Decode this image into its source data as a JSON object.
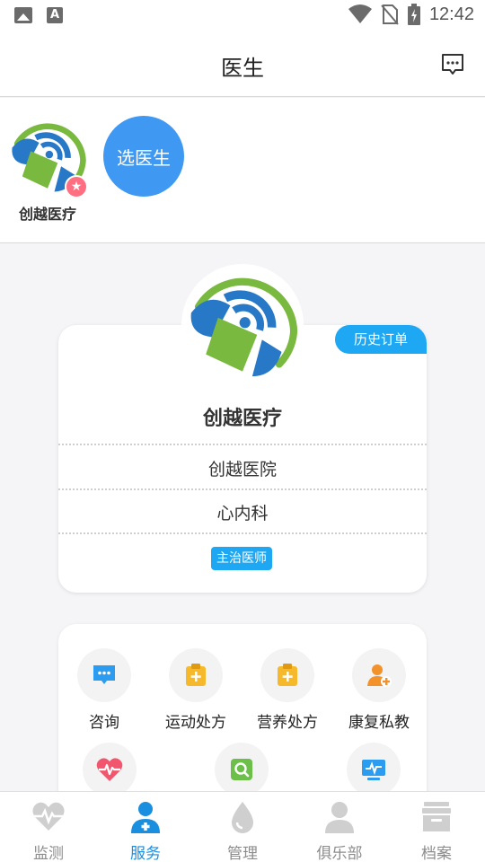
{
  "status_bar": {
    "time": "12:42",
    "icons": [
      "image-notification-icon",
      "accessibility-notification-icon",
      "wifi-icon",
      "no-sim-icon",
      "battery-charging-icon"
    ]
  },
  "header": {
    "title": "医生",
    "message_icon": "chat-bubble-icon"
  },
  "doctor_strip": {
    "doctors": [
      {
        "name": "创越医疗",
        "badge_icon": "star-icon"
      }
    ],
    "choose_label": "选医生"
  },
  "profile": {
    "history_label": "历史订单",
    "name": "创越医疗",
    "hospital": "创越医院",
    "department": "心内科",
    "title_tag": "主治医师"
  },
  "services": {
    "items": [
      {
        "label": "咨询",
        "icon": "chat-icon",
        "color": "#2c9cf0"
      },
      {
        "label": "运动处方",
        "icon": "clipboard-plus-icon",
        "color": "#f6b92b"
      },
      {
        "label": "营养处方",
        "icon": "clipboard-plus-icon",
        "color": "#f6b92b"
      },
      {
        "label": "康复私教",
        "icon": "person-add-icon",
        "color": "#f3922b"
      },
      {
        "label": "",
        "icon": "heart-rate-icon",
        "color": "#f2566e"
      },
      {
        "label": "",
        "icon": "search-report-icon",
        "color": "#6cc04a"
      },
      {
        "label": "",
        "icon": "monitor-icon",
        "color": "#2c9cf0"
      }
    ]
  },
  "bottom_nav": {
    "items": [
      {
        "label": "监测",
        "icon": "heart-pulse-icon",
        "active": false
      },
      {
        "label": "服务",
        "icon": "doctor-plus-icon",
        "active": true
      },
      {
        "label": "管理",
        "icon": "water-drop-icon",
        "active": false
      },
      {
        "label": "俱乐部",
        "icon": "person-icon",
        "active": false
      },
      {
        "label": "档案",
        "icon": "archive-box-icon",
        "active": false
      }
    ],
    "active_color": "#1a8fe0",
    "inactive_color": "#8c8c8c"
  },
  "colors": {
    "brand_blue": "#3f99f3",
    "accent_blue": "#1ea8f4",
    "logo_green": "#7ab940",
    "logo_blue": "#2878c8"
  }
}
